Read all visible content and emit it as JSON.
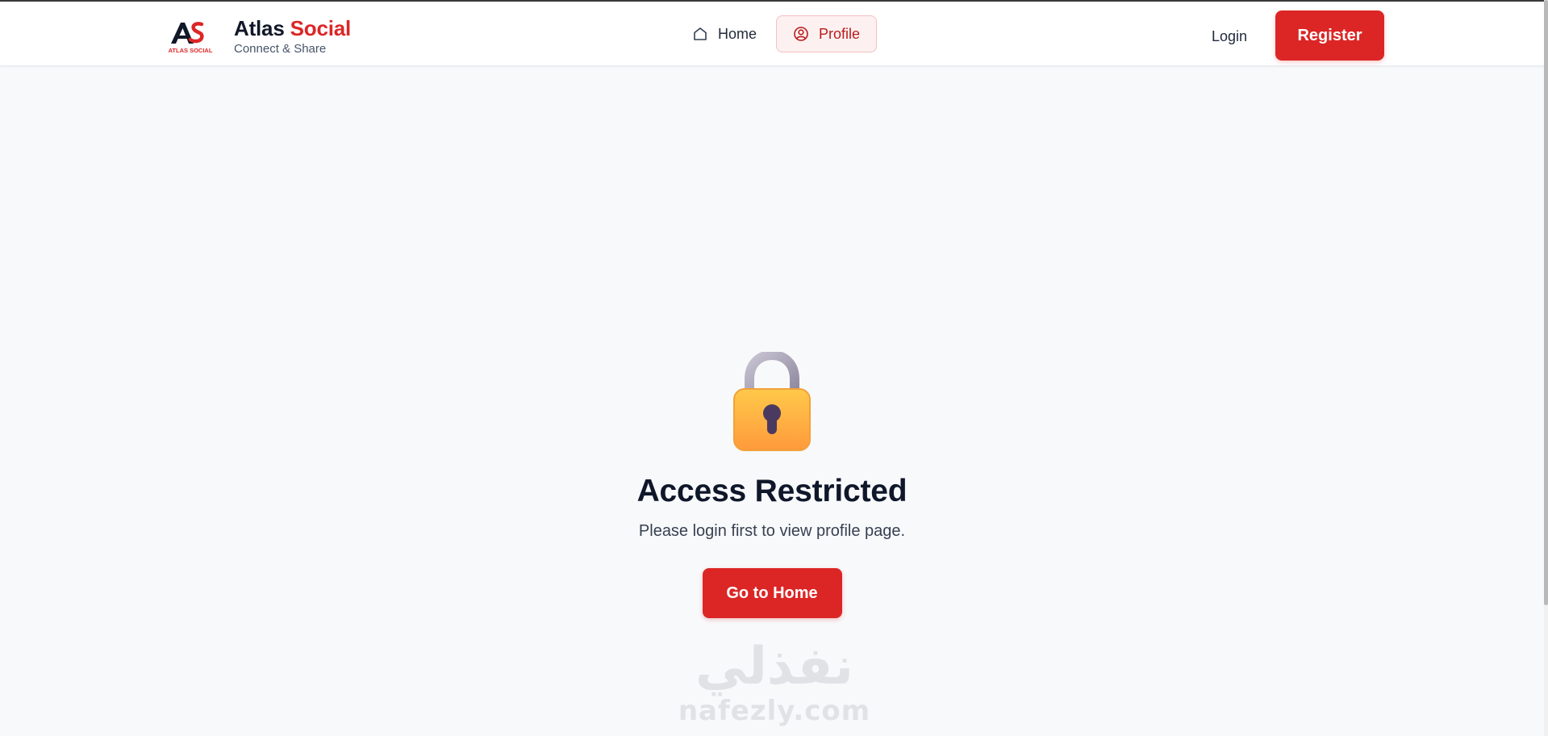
{
  "brand": {
    "logo_caption": "ATLAS SOCIAL",
    "title_part1": "Atlas",
    "title_part2": "Social",
    "tagline": "Connect & Share"
  },
  "nav": {
    "home_label": "Home",
    "profile_label": "Profile",
    "active_tab": "Profile"
  },
  "auth": {
    "login_label": "Login",
    "register_label": "Register"
  },
  "restricted": {
    "title": "Access Restricted",
    "message": "Please login first to view profile page.",
    "button_label": "Go to Home"
  },
  "watermark": {
    "arabic": "نفذلي",
    "latin": "nafezly.com"
  },
  "colors": {
    "accent": "#dc2626",
    "background": "#f8f9fb",
    "header_bg": "#ffffff",
    "active_tab_bg": "#fdf0f0"
  },
  "icons": {
    "home": "home-icon",
    "profile": "user-circle-icon",
    "lock": "padlock-icon"
  }
}
